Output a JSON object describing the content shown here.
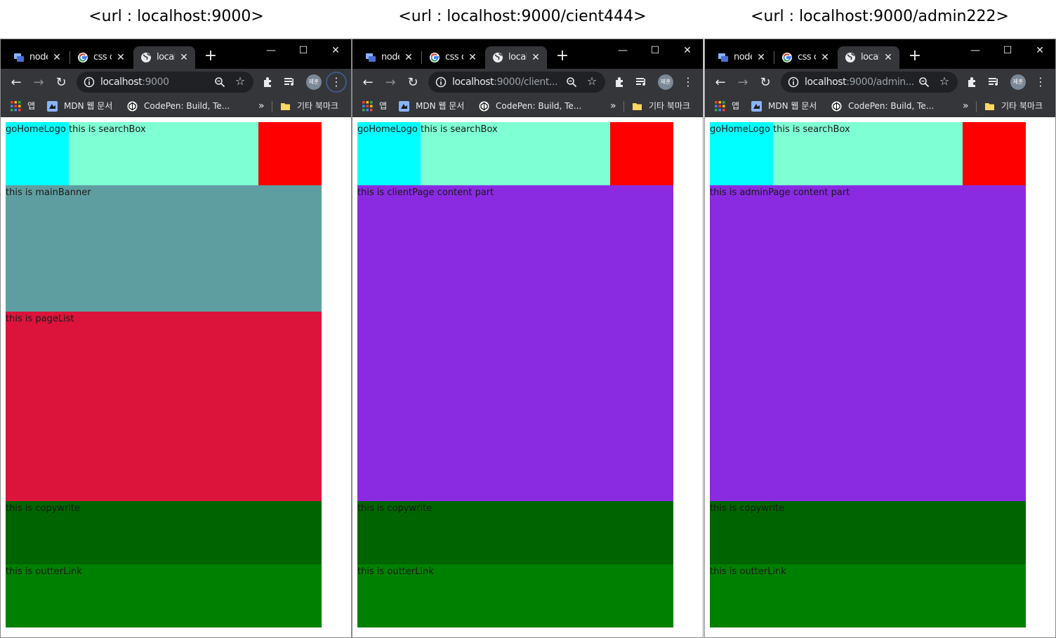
{
  "captions": [
    "<url : localhost:9000>",
    "<url : localhost:9000/cient444>",
    "<url : localhost:9000/admin222>"
  ],
  "browsers": [
    {
      "tabs": [
        {
          "label": "node"
        },
        {
          "label": "css c"
        },
        {
          "label": "local"
        }
      ],
      "address": {
        "host": "localhost",
        "rest": ":9000"
      },
      "profile": "제훈",
      "bookmarks": {
        "apps": "앱",
        "mdn": "MDN 웹 문서",
        "codepen": "CodePen: Build, Te...",
        "overflow": "»",
        "other": "기타 북마크"
      },
      "header": {
        "logo": "goHomeLogo",
        "search": "this is searchBox"
      },
      "sections": [
        "this is mainBanner",
        "this is pageList",
        "this is copywrite",
        "this is outterLink"
      ]
    },
    {
      "tabs": [
        {
          "label": "node"
        },
        {
          "label": "css c"
        },
        {
          "label": "local"
        }
      ],
      "address": {
        "host": "localhost",
        "rest": ":9000/client..."
      },
      "profile": "제훈",
      "bookmarks": {
        "apps": "앱",
        "mdn": "MDN 웹 문서",
        "codepen": "CodePen: Build, Te...",
        "overflow": "»",
        "other": "기타 북마크"
      },
      "header": {
        "logo": "goHomeLogo",
        "search": "this is searchBox"
      },
      "sections": [
        "this is clientPage content part",
        "this is copywrite",
        "this is outterLink"
      ]
    },
    {
      "tabs": [
        {
          "label": "node"
        },
        {
          "label": "css c"
        },
        {
          "label": "local"
        }
      ],
      "address": {
        "host": "localhost",
        "rest": ":9000/admin..."
      },
      "profile": "제훈",
      "bookmarks": {
        "apps": "앱",
        "mdn": "MDN 웹 문서",
        "codepen": "CodePen: Build, Te...",
        "overflow": "»",
        "other": "기타 북마크"
      },
      "header": {
        "logo": "goHomeLogo",
        "search": "this is searchBox"
      },
      "sections": [
        "this is adminPage content part",
        "this is copywrite",
        "this is outterLink"
      ]
    }
  ],
  "colors": {
    "logo": "#00ffff",
    "search": "#7fffd4",
    "headerRight": "#ff0000",
    "mainBanner": "#5f9ea0",
    "pageList": "#dc143c",
    "content": "#8a2be2",
    "copywrite": "#006400",
    "outterLink": "#008000"
  }
}
